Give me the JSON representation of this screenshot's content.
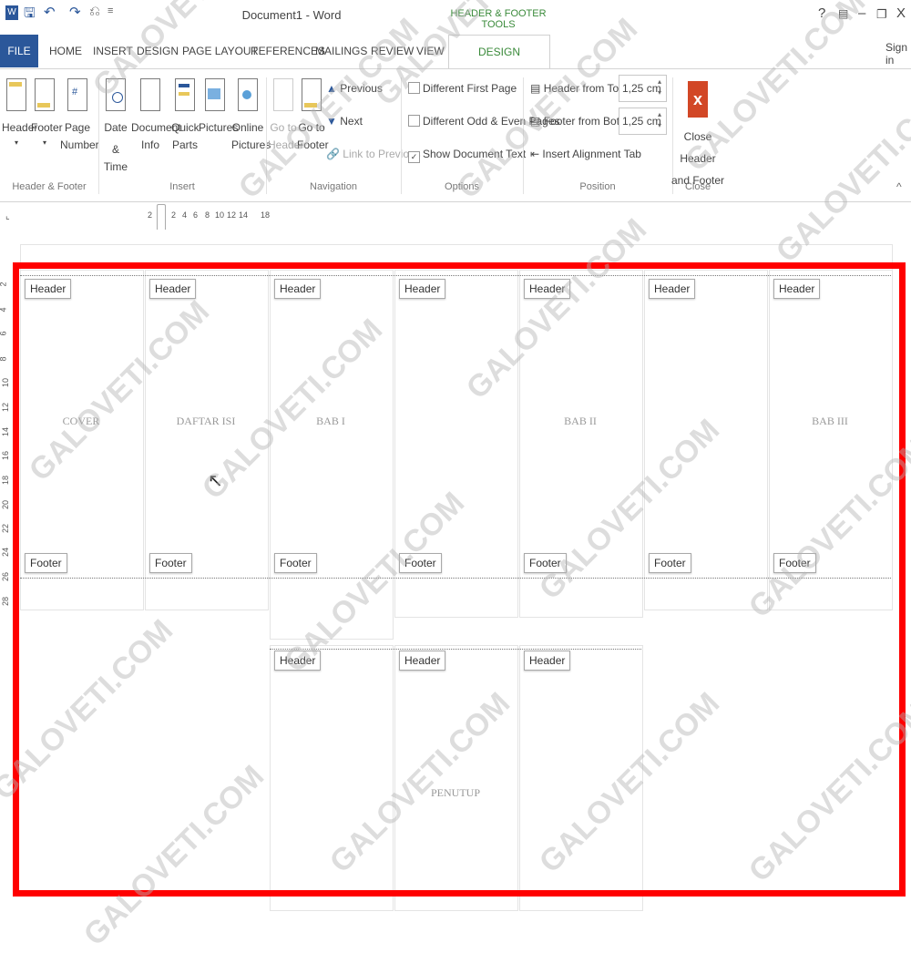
{
  "window": {
    "title": "Document1 - Word",
    "contextual_tab_group": "HEADER & FOOTER TOOLS",
    "help": "?",
    "minimize": "–",
    "restore": "❐",
    "close": "X",
    "sign_in": "Sign in"
  },
  "tabs": {
    "file": "FILE",
    "home": "HOME",
    "insert": "INSERT",
    "design": "DESIGN",
    "page_layout": "PAGE LAYOUT",
    "references": "REFERENCES",
    "mailings": "MAILINGS",
    "review": "REVIEW",
    "view": "VIEW",
    "hf_design": "DESIGN"
  },
  "ribbon": {
    "header_btn": "Header",
    "footer_btn": "Footer",
    "page_number_l1": "Page",
    "page_number_l2": "Number",
    "group_header_footer": "Header & Footer",
    "date_time_l1": "Date &",
    "date_time_l2": "Time",
    "document_info_l1": "Document",
    "document_info_l2": "Info",
    "quick_parts_l1": "Quick",
    "quick_parts_l2": "Parts",
    "pictures": "Pictures",
    "online_pictures_l1": "Online",
    "online_pictures_l2": "Pictures",
    "group_insert": "Insert",
    "goto_header_l1": "Go to",
    "goto_header_l2": "Header",
    "goto_footer_l1": "Go to",
    "goto_footer_l2": "Footer",
    "previous": "Previous",
    "next": "Next",
    "link_to_previous": "Link to Previous",
    "group_navigation": "Navigation",
    "different_first_page": "Different First Page",
    "different_odd_even": "Different Odd & Even Pages",
    "show_document_text": "Show Document Text",
    "group_options": "Options",
    "header_from_top": "Header from Top:",
    "header_from_top_value": "1,25 cm",
    "footer_from_bottom": "Footer from Bottom:",
    "footer_from_bottom_value": "1,25 cm",
    "insert_alignment_tab": "Insert Alignment Tab",
    "group_position": "Position",
    "close_l1": "Close Header",
    "close_l2": "and Footer",
    "group_close": "Close",
    "collapse": "^"
  },
  "ruler": {
    "marks": [
      "2",
      "2",
      "4",
      "6",
      "8",
      "10",
      "12",
      "14",
      "18"
    ]
  },
  "vertical_ruler": {
    "marks": [
      "2",
      "4",
      "6",
      "8",
      "10",
      "12",
      "14",
      "16",
      "18",
      "20",
      "22",
      "24",
      "26",
      "28"
    ]
  },
  "labels": {
    "header": "Header",
    "footer": "Footer"
  },
  "pages": {
    "cover": "COVER",
    "daftar_isi": "DAFTAR ISI",
    "bab1": "BAB I",
    "bab2": "BAB II",
    "bab3": "BAB III",
    "penutup": "PENUTUP"
  },
  "watermark": "GALOVETI.COM",
  "colors": {
    "accent_blue": "#2b579a",
    "contextual_green": "#3a8a3a",
    "highlight_red": "#ff0000",
    "close_icon": "#d24726"
  }
}
